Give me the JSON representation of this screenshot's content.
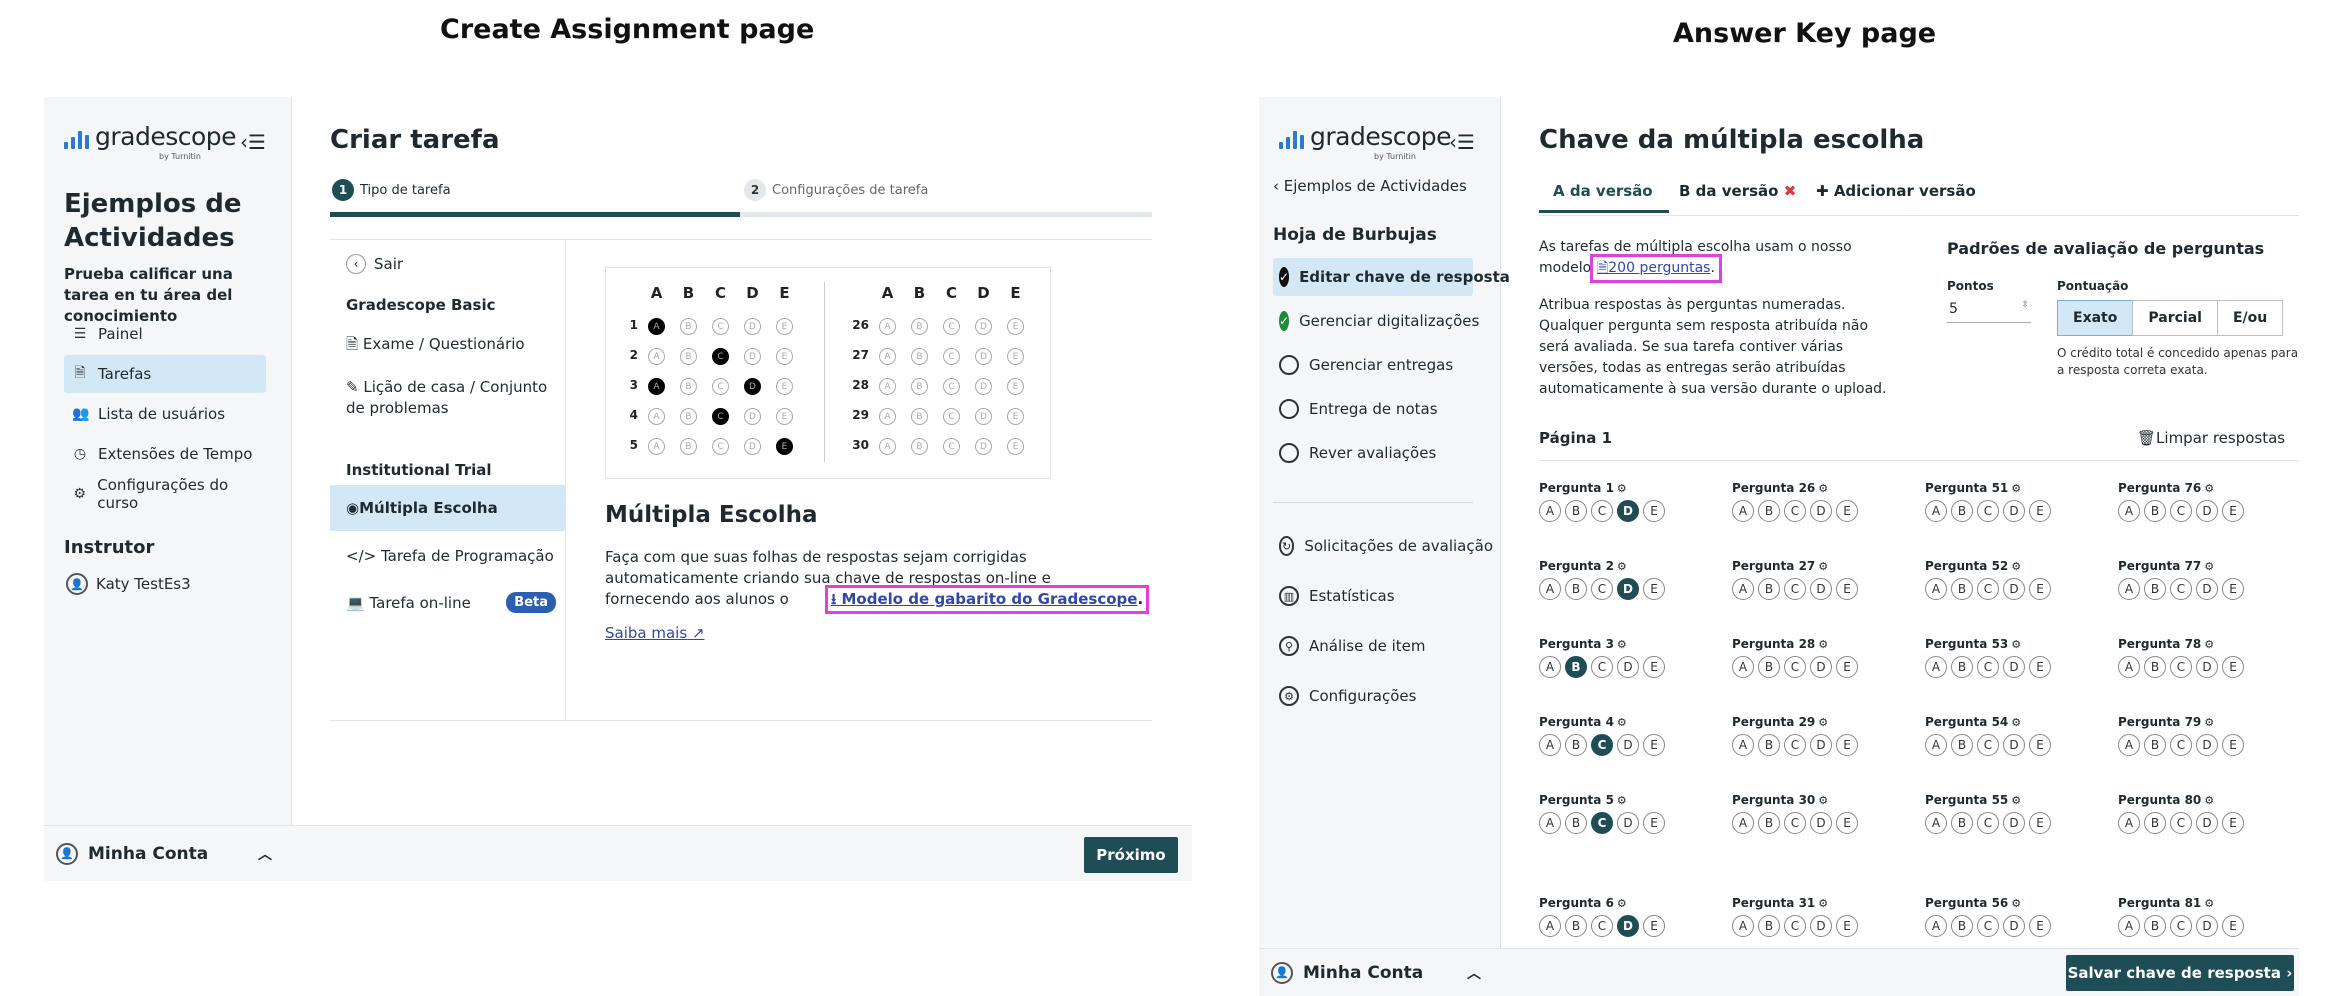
{
  "captions": {
    "left": "Create Assignment page",
    "right": "Answer Key page"
  },
  "left": {
    "logo": "gradescope",
    "logo_sub": "by Turnitin",
    "course_title": "Ejemplos de Actividades",
    "course_desc": "Prueba calificar una tarea en tu área del conocimiento",
    "nav": [
      {
        "label": "Painel",
        "icon": "dashboard-icon"
      },
      {
        "label": "Tarefas",
        "icon": "document-icon"
      },
      {
        "label": "Lista de usuários",
        "icon": "users-icon"
      },
      {
        "label": "Extensões de Tempo",
        "icon": "clock-icon"
      },
      {
        "label": "Configurações do curso",
        "icon": "gear-icon"
      }
    ],
    "instructor_heading": "Instrutor",
    "instructor_name": "Katy TestEs3",
    "account": "Minha Conta",
    "page_title": "Criar tarefa",
    "steps": [
      {
        "num": "1",
        "label": "Tipo de tarefa"
      },
      {
        "num": "2",
        "label": "Configurações de tarefa"
      }
    ],
    "back": "Sair",
    "group1": "Gradescope Basic",
    "types1": [
      "Exame / Questionário",
      "Lição de casa / Conjunto de problemas"
    ],
    "group2": "Institutional Trial",
    "types2": [
      "Múltipla Escolha",
      "Tarefa de Programação",
      "Tarefa on-line"
    ],
    "beta": "Beta",
    "bubble_letters": [
      "A",
      "B",
      "C",
      "D",
      "E"
    ],
    "bubble_rows_left": [
      "1",
      "2",
      "3",
      "4",
      "5"
    ],
    "bubble_rows_right": [
      "26",
      "27",
      "28",
      "29",
      "30"
    ],
    "mc_title": "Múltipla Escolha",
    "mc_desc": "Faça com que suas folhas de respostas sejam corrigidas automaticamente criando sua chave de respostas on-line e fornecendo aos alunos o",
    "mc_link": "Modelo de gabarito do Gradescope",
    "learn_more": "Saiba mais",
    "next": "Próximo"
  },
  "right": {
    "logo": "gradescope",
    "logo_sub": "by Turnitin",
    "back": "Ejemplos de Actividades",
    "section": "Hoja de Burbujas",
    "steps": [
      {
        "label": "Editar chave de resposta",
        "state": "active"
      },
      {
        "label": "Gerenciar digitalizações",
        "state": "done"
      },
      {
        "label": "Gerenciar entregas",
        "state": "todo"
      },
      {
        "label": "Entrega de notas",
        "state": "todo"
      },
      {
        "label": "Rever avaliações",
        "state": "todo"
      }
    ],
    "tools": [
      {
        "label": "Solicitações de avaliação",
        "icon": "regrade-icon"
      },
      {
        "label": "Estatísticas",
        "icon": "stats-icon"
      },
      {
        "label": "Análise de item",
        "icon": "search-icon"
      },
      {
        "label": "Configurações",
        "icon": "gear-icon"
      }
    ],
    "account": "Minha Conta",
    "page_title": "Chave da múltipla escolha",
    "tabs": [
      "A da versão",
      "B da versão",
      "Adicionar versão"
    ],
    "intro1": "As tarefas de múltipla escolha usam o nosso modelo",
    "intro_link": "200 perguntas",
    "intro2": "Atribua respostas às perguntas numeradas. Qualquer pergunta sem resposta atribuída não será avaliada. Se sua tarefa contiver várias versões, todas as entregas serão atribuídas automaticamente à sua versão durante o upload.",
    "defaults_title": "Padrões de avaliação de perguntas",
    "points_label": "Pontos",
    "points_value": "5",
    "scoring_label": "Pontuação",
    "scoring": [
      "Exato",
      "Parcial",
      "E/ou"
    ],
    "scoring_note": "O crédito total é concedido apenas para a resposta correta exata.",
    "page_label": "Página 1",
    "clear": "Limpar respostas",
    "question_prefix": "Pergunta",
    "columns": [
      [
        {
          "n": "1",
          "sel": "D"
        },
        {
          "n": "2",
          "sel": "D"
        },
        {
          "n": "3",
          "sel": "B"
        },
        {
          "n": "4",
          "sel": "C"
        },
        {
          "n": "5",
          "sel": "C"
        },
        {
          "n": "6",
          "sel": "D"
        }
      ],
      [
        {
          "n": "26",
          "sel": ""
        },
        {
          "n": "27",
          "sel": ""
        },
        {
          "n": "28",
          "sel": ""
        },
        {
          "n": "29",
          "sel": ""
        },
        {
          "n": "30",
          "sel": ""
        },
        {
          "n": "31",
          "sel": ""
        }
      ],
      [
        {
          "n": "51",
          "sel": ""
        },
        {
          "n": "52",
          "sel": ""
        },
        {
          "n": "53",
          "sel": ""
        },
        {
          "n": "54",
          "sel": ""
        },
        {
          "n": "55",
          "sel": ""
        },
        {
          "n": "56",
          "sel": ""
        }
      ],
      [
        {
          "n": "76",
          "sel": ""
        },
        {
          "n": "77",
          "sel": ""
        },
        {
          "n": "78",
          "sel": ""
        },
        {
          "n": "79",
          "sel": ""
        },
        {
          "n": "80",
          "sel": ""
        },
        {
          "n": "81",
          "sel": ""
        }
      ]
    ],
    "save": "Salvar chave de resposta",
    "colors": {
      "primary": "#1f4d55",
      "highlight": "#e040e0",
      "active_bg": "#d3e8f6",
      "done": "#1f8a3c"
    }
  }
}
